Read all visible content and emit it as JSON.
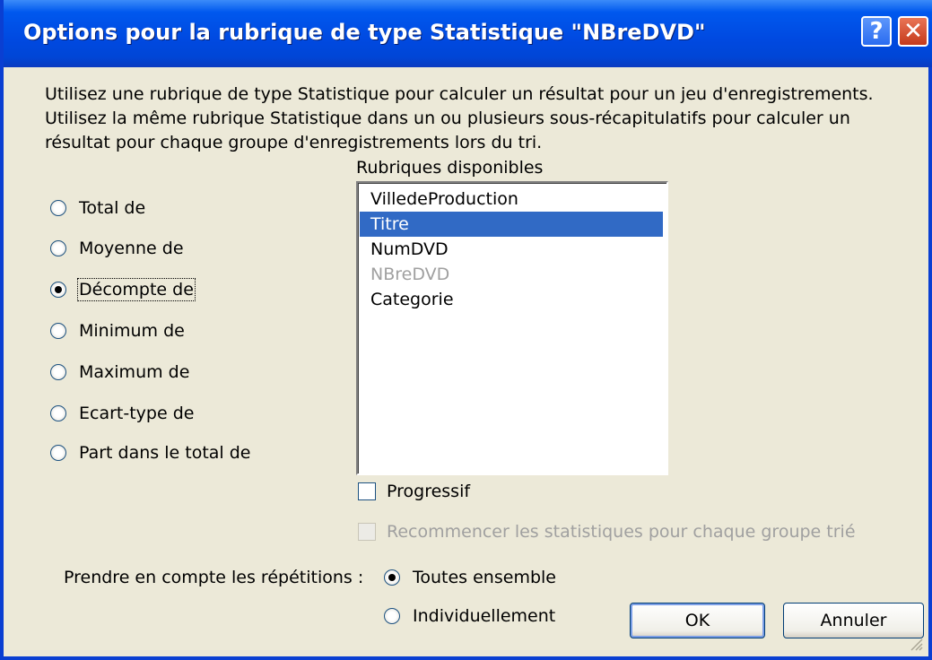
{
  "window": {
    "title": "Options pour la rubrique de type Statistique \"NBreDVD\"",
    "help_glyph": "?",
    "close_glyph": "✕"
  },
  "description": [
    "Utilisez une rubrique de type Statistique pour calculer un résultat pour un jeu d'enregistrements.",
    "Utilisez la même rubrique Statistique dans un ou plusieurs sous-récapitulatifs pour calculer un",
    "résultat pour chaque groupe d'enregistrements lors du tri."
  ],
  "summary_options": [
    {
      "label": "Total de",
      "checked": false
    },
    {
      "label": "Moyenne de",
      "checked": false
    },
    {
      "label": "Décompte de",
      "checked": true
    },
    {
      "label": "Minimum de",
      "checked": false
    },
    {
      "label": "Maximum de",
      "checked": false
    },
    {
      "label": "Ecart-type de",
      "checked": false
    },
    {
      "label": "Part dans le total de",
      "checked": false
    }
  ],
  "available_fields": {
    "label": "Rubriques disponibles",
    "items": [
      {
        "label": "VilledeProduction",
        "state": "normal"
      },
      {
        "label": "Titre",
        "state": "selected"
      },
      {
        "label": "NumDVD",
        "state": "normal"
      },
      {
        "label": "NBreDVD",
        "state": "disabled"
      },
      {
        "label": "Categorie",
        "state": "normal"
      }
    ]
  },
  "progressive": {
    "label": "Progressif",
    "checked": false
  },
  "restart": {
    "label": "Recommencer les statistiques pour chaque groupe trié",
    "checked": false,
    "enabled": false
  },
  "repetitions": {
    "label": "Prendre en compte les répétitions :",
    "options": [
      {
        "label": "Toutes ensemble",
        "checked": true
      },
      {
        "label": "Individuellement",
        "checked": false
      }
    ]
  },
  "buttons": {
    "ok": "OK",
    "cancel": "Annuler"
  },
  "colors": {
    "titlebar": "#0058ee",
    "selection": "#316ac5",
    "dialog_bg": "#ece9d8"
  }
}
